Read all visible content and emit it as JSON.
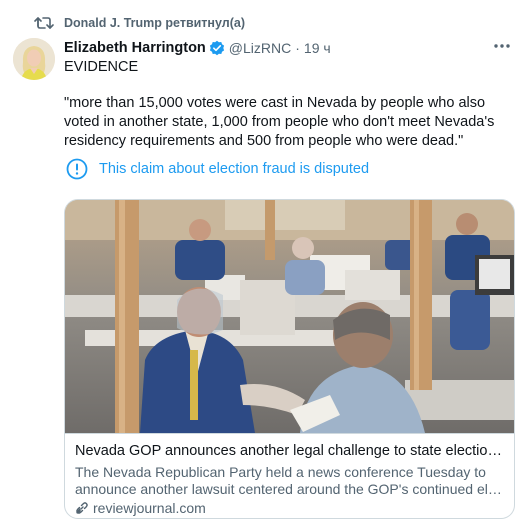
{
  "retweet": {
    "icon": "retweet-icon",
    "text": "Donald J. Trump ретвитнул(а)"
  },
  "author": {
    "name": "Elizabeth Harrington",
    "verified": true,
    "handle": "@LizRNC",
    "separator": "·",
    "time": "19 ч"
  },
  "tweet": {
    "line1": "EVIDENCE",
    "quote": "\"more than 15,000 votes were cast in Nevada by people who also voted in another state, 1,000 from people who don't meet Nevada's residency requirements and 500 from people who were dead.\""
  },
  "claim_label": {
    "icon": "info-circle-icon",
    "text": "This claim about election fraud is disputed"
  },
  "card": {
    "title": "Nevada GOP announces another legal challenge to state election results",
    "description_line1": "The Nevada Republican Party held a news conference Tuesday to",
    "description_line2": "announce another lawsuit centered around the GOP's continued election…",
    "domain": "reviewjournal.com",
    "icon": "link-icon"
  },
  "colors": {
    "accent": "#1d9bf0",
    "text": "#0f1419",
    "secondary": "#536471",
    "border": "#cfd9de"
  }
}
